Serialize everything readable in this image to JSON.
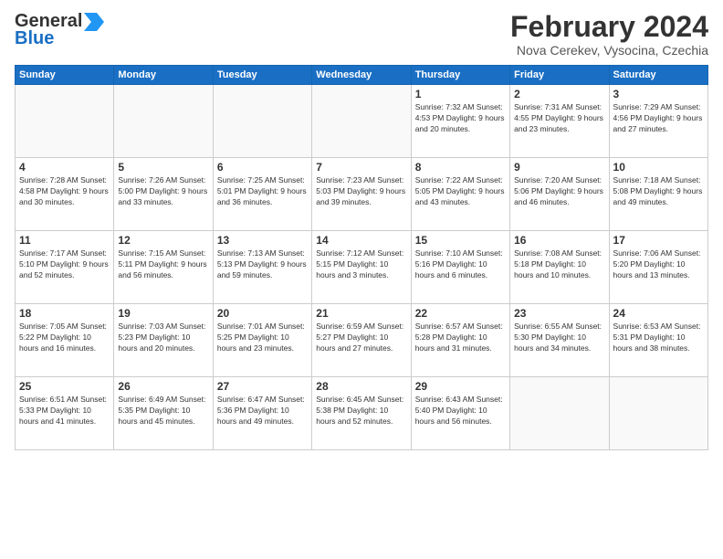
{
  "header": {
    "logo_line1a": "General",
    "logo_line1b": "Blue",
    "month_title": "February 2024",
    "location": "Nova Cerekev, Vysocina, Czechia"
  },
  "days_of_week": [
    "Sunday",
    "Monday",
    "Tuesday",
    "Wednesday",
    "Thursday",
    "Friday",
    "Saturday"
  ],
  "weeks": [
    [
      {
        "day": "",
        "info": ""
      },
      {
        "day": "",
        "info": ""
      },
      {
        "day": "",
        "info": ""
      },
      {
        "day": "",
        "info": ""
      },
      {
        "day": "1",
        "info": "Sunrise: 7:32 AM\nSunset: 4:53 PM\nDaylight: 9 hours\nand 20 minutes."
      },
      {
        "day": "2",
        "info": "Sunrise: 7:31 AM\nSunset: 4:55 PM\nDaylight: 9 hours\nand 23 minutes."
      },
      {
        "day": "3",
        "info": "Sunrise: 7:29 AM\nSunset: 4:56 PM\nDaylight: 9 hours\nand 27 minutes."
      }
    ],
    [
      {
        "day": "4",
        "info": "Sunrise: 7:28 AM\nSunset: 4:58 PM\nDaylight: 9 hours\nand 30 minutes."
      },
      {
        "day": "5",
        "info": "Sunrise: 7:26 AM\nSunset: 5:00 PM\nDaylight: 9 hours\nand 33 minutes."
      },
      {
        "day": "6",
        "info": "Sunrise: 7:25 AM\nSunset: 5:01 PM\nDaylight: 9 hours\nand 36 minutes."
      },
      {
        "day": "7",
        "info": "Sunrise: 7:23 AM\nSunset: 5:03 PM\nDaylight: 9 hours\nand 39 minutes."
      },
      {
        "day": "8",
        "info": "Sunrise: 7:22 AM\nSunset: 5:05 PM\nDaylight: 9 hours\nand 43 minutes."
      },
      {
        "day": "9",
        "info": "Sunrise: 7:20 AM\nSunset: 5:06 PM\nDaylight: 9 hours\nand 46 minutes."
      },
      {
        "day": "10",
        "info": "Sunrise: 7:18 AM\nSunset: 5:08 PM\nDaylight: 9 hours\nand 49 minutes."
      }
    ],
    [
      {
        "day": "11",
        "info": "Sunrise: 7:17 AM\nSunset: 5:10 PM\nDaylight: 9 hours\nand 52 minutes."
      },
      {
        "day": "12",
        "info": "Sunrise: 7:15 AM\nSunset: 5:11 PM\nDaylight: 9 hours\nand 56 minutes."
      },
      {
        "day": "13",
        "info": "Sunrise: 7:13 AM\nSunset: 5:13 PM\nDaylight: 9 hours\nand 59 minutes."
      },
      {
        "day": "14",
        "info": "Sunrise: 7:12 AM\nSunset: 5:15 PM\nDaylight: 10 hours\nand 3 minutes."
      },
      {
        "day": "15",
        "info": "Sunrise: 7:10 AM\nSunset: 5:16 PM\nDaylight: 10 hours\nand 6 minutes."
      },
      {
        "day": "16",
        "info": "Sunrise: 7:08 AM\nSunset: 5:18 PM\nDaylight: 10 hours\nand 10 minutes."
      },
      {
        "day": "17",
        "info": "Sunrise: 7:06 AM\nSunset: 5:20 PM\nDaylight: 10 hours\nand 13 minutes."
      }
    ],
    [
      {
        "day": "18",
        "info": "Sunrise: 7:05 AM\nSunset: 5:22 PM\nDaylight: 10 hours\nand 16 minutes."
      },
      {
        "day": "19",
        "info": "Sunrise: 7:03 AM\nSunset: 5:23 PM\nDaylight: 10 hours\nand 20 minutes."
      },
      {
        "day": "20",
        "info": "Sunrise: 7:01 AM\nSunset: 5:25 PM\nDaylight: 10 hours\nand 23 minutes."
      },
      {
        "day": "21",
        "info": "Sunrise: 6:59 AM\nSunset: 5:27 PM\nDaylight: 10 hours\nand 27 minutes."
      },
      {
        "day": "22",
        "info": "Sunrise: 6:57 AM\nSunset: 5:28 PM\nDaylight: 10 hours\nand 31 minutes."
      },
      {
        "day": "23",
        "info": "Sunrise: 6:55 AM\nSunset: 5:30 PM\nDaylight: 10 hours\nand 34 minutes."
      },
      {
        "day": "24",
        "info": "Sunrise: 6:53 AM\nSunset: 5:31 PM\nDaylight: 10 hours\nand 38 minutes."
      }
    ],
    [
      {
        "day": "25",
        "info": "Sunrise: 6:51 AM\nSunset: 5:33 PM\nDaylight: 10 hours\nand 41 minutes."
      },
      {
        "day": "26",
        "info": "Sunrise: 6:49 AM\nSunset: 5:35 PM\nDaylight: 10 hours\nand 45 minutes."
      },
      {
        "day": "27",
        "info": "Sunrise: 6:47 AM\nSunset: 5:36 PM\nDaylight: 10 hours\nand 49 minutes."
      },
      {
        "day": "28",
        "info": "Sunrise: 6:45 AM\nSunset: 5:38 PM\nDaylight: 10 hours\nand 52 minutes."
      },
      {
        "day": "29",
        "info": "Sunrise: 6:43 AM\nSunset: 5:40 PM\nDaylight: 10 hours\nand 56 minutes."
      },
      {
        "day": "",
        "info": ""
      },
      {
        "day": "",
        "info": ""
      }
    ]
  ]
}
